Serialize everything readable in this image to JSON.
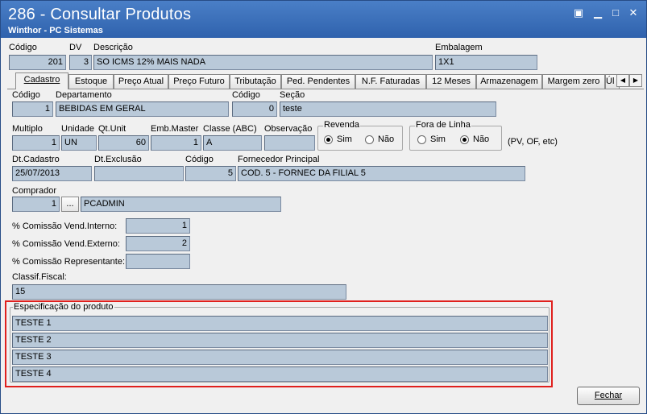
{
  "window": {
    "title": "286 - Consultar Produtos",
    "subtitle": "Winthor - PC Sistemas"
  },
  "header": {
    "codigo_label": "Código",
    "codigo": "201",
    "dv_label": "DV",
    "dv": "3",
    "descricao_label": "Descrição",
    "descricao": "SO ICMS 12% MAIS NADA",
    "embalagem_label": "Embalagem",
    "embalagem": "1X1"
  },
  "tabs": [
    {
      "label": "Cadastro"
    },
    {
      "label": "Estoque"
    },
    {
      "label": "Preço Atual"
    },
    {
      "label": "Preço Futuro"
    },
    {
      "label": "Tributação"
    },
    {
      "label": "Ped. Pendentes"
    },
    {
      "label": "N.F. Faturadas"
    },
    {
      "label": "12 Meses"
    },
    {
      "label": "Armazenagem"
    },
    {
      "label": "Margem zero"
    },
    {
      "label": "Úl"
    }
  ],
  "cadastro": {
    "codigo_label": "Código",
    "codigo": "1",
    "departamento_label": "Departamento",
    "departamento": "BEBIDAS EM GERAL",
    "codigo2_label": "Código",
    "codigo2": "0",
    "secao_label": "Seção",
    "secao": "teste",
    "multiplo_label": "Multiplo",
    "multiplo": "1",
    "unidade_label": "Unidade",
    "unidade": "UN",
    "qtunit_label": "Qt.Unit",
    "qtunit": "60",
    "embmaster_label": "Emb.Master",
    "embmaster": "1",
    "classe_label": "Classe (ABC)",
    "classe": "A",
    "observacao_label": "Observação",
    "observacao": "",
    "revenda_label": "Revenda",
    "revenda_sim": "Sim",
    "revenda_nao": "Não",
    "foralinha_label": "Fora de Linha",
    "foralinha_sim": "Sim",
    "foralinha_nao": "Não",
    "pv_note": "(PV, OF, etc)",
    "dtcadastro_label": "Dt.Cadastro",
    "dtcadastro": "25/07/2013",
    "dtexclusao_label": "Dt.Exclusão",
    "dtexclusao": "",
    "codigo3_label": "Código",
    "codigo3": "5",
    "fornecedor_label": "Fornecedor Principal",
    "fornecedor": "COD. 5 - FORNEC DA FILIAL 5",
    "comprador_label": "Comprador",
    "comprador_codigo": "1",
    "comprador_btn": "...",
    "comprador": "PCADMIN",
    "comissao_interno_label": "% Comissão Vend.Interno:",
    "comissao_interno": "1",
    "comissao_externo_label": "% Comissão Vend.Externo:",
    "comissao_externo": "2",
    "comissao_rep_label": "% Comissão Representante:",
    "comissao_rep": "",
    "classif_label": "Classif.Fiscal:",
    "classif": "15",
    "spec_label": "Especificação do produto",
    "spec": [
      "TESTE 1",
      "TESTE 2",
      "TESTE 3",
      "TESTE 4"
    ]
  },
  "footer": {
    "fechar": "Fechar"
  }
}
